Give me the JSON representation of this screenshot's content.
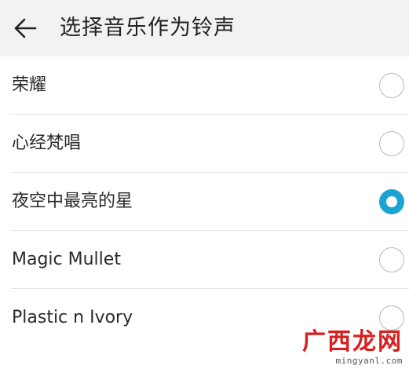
{
  "header": {
    "title": "选择音乐作为铃声",
    "back_icon": "arrow-left-icon"
  },
  "ringtones": [
    {
      "label": "荣耀",
      "selected": false
    },
    {
      "label": "心经梵唱",
      "selected": false
    },
    {
      "label": "夜空中最亮的星",
      "selected": true
    },
    {
      "label": "Magic Mullet",
      "selected": false
    },
    {
      "label": "Plastic n Ivory",
      "selected": false
    }
  ],
  "colors": {
    "accent": "#1ba3d4",
    "header_background": "#f2f2f2",
    "watermark": "#d81e1e"
  },
  "watermark": {
    "logo_text": "广西龙网",
    "url": "mingyanl.com"
  }
}
